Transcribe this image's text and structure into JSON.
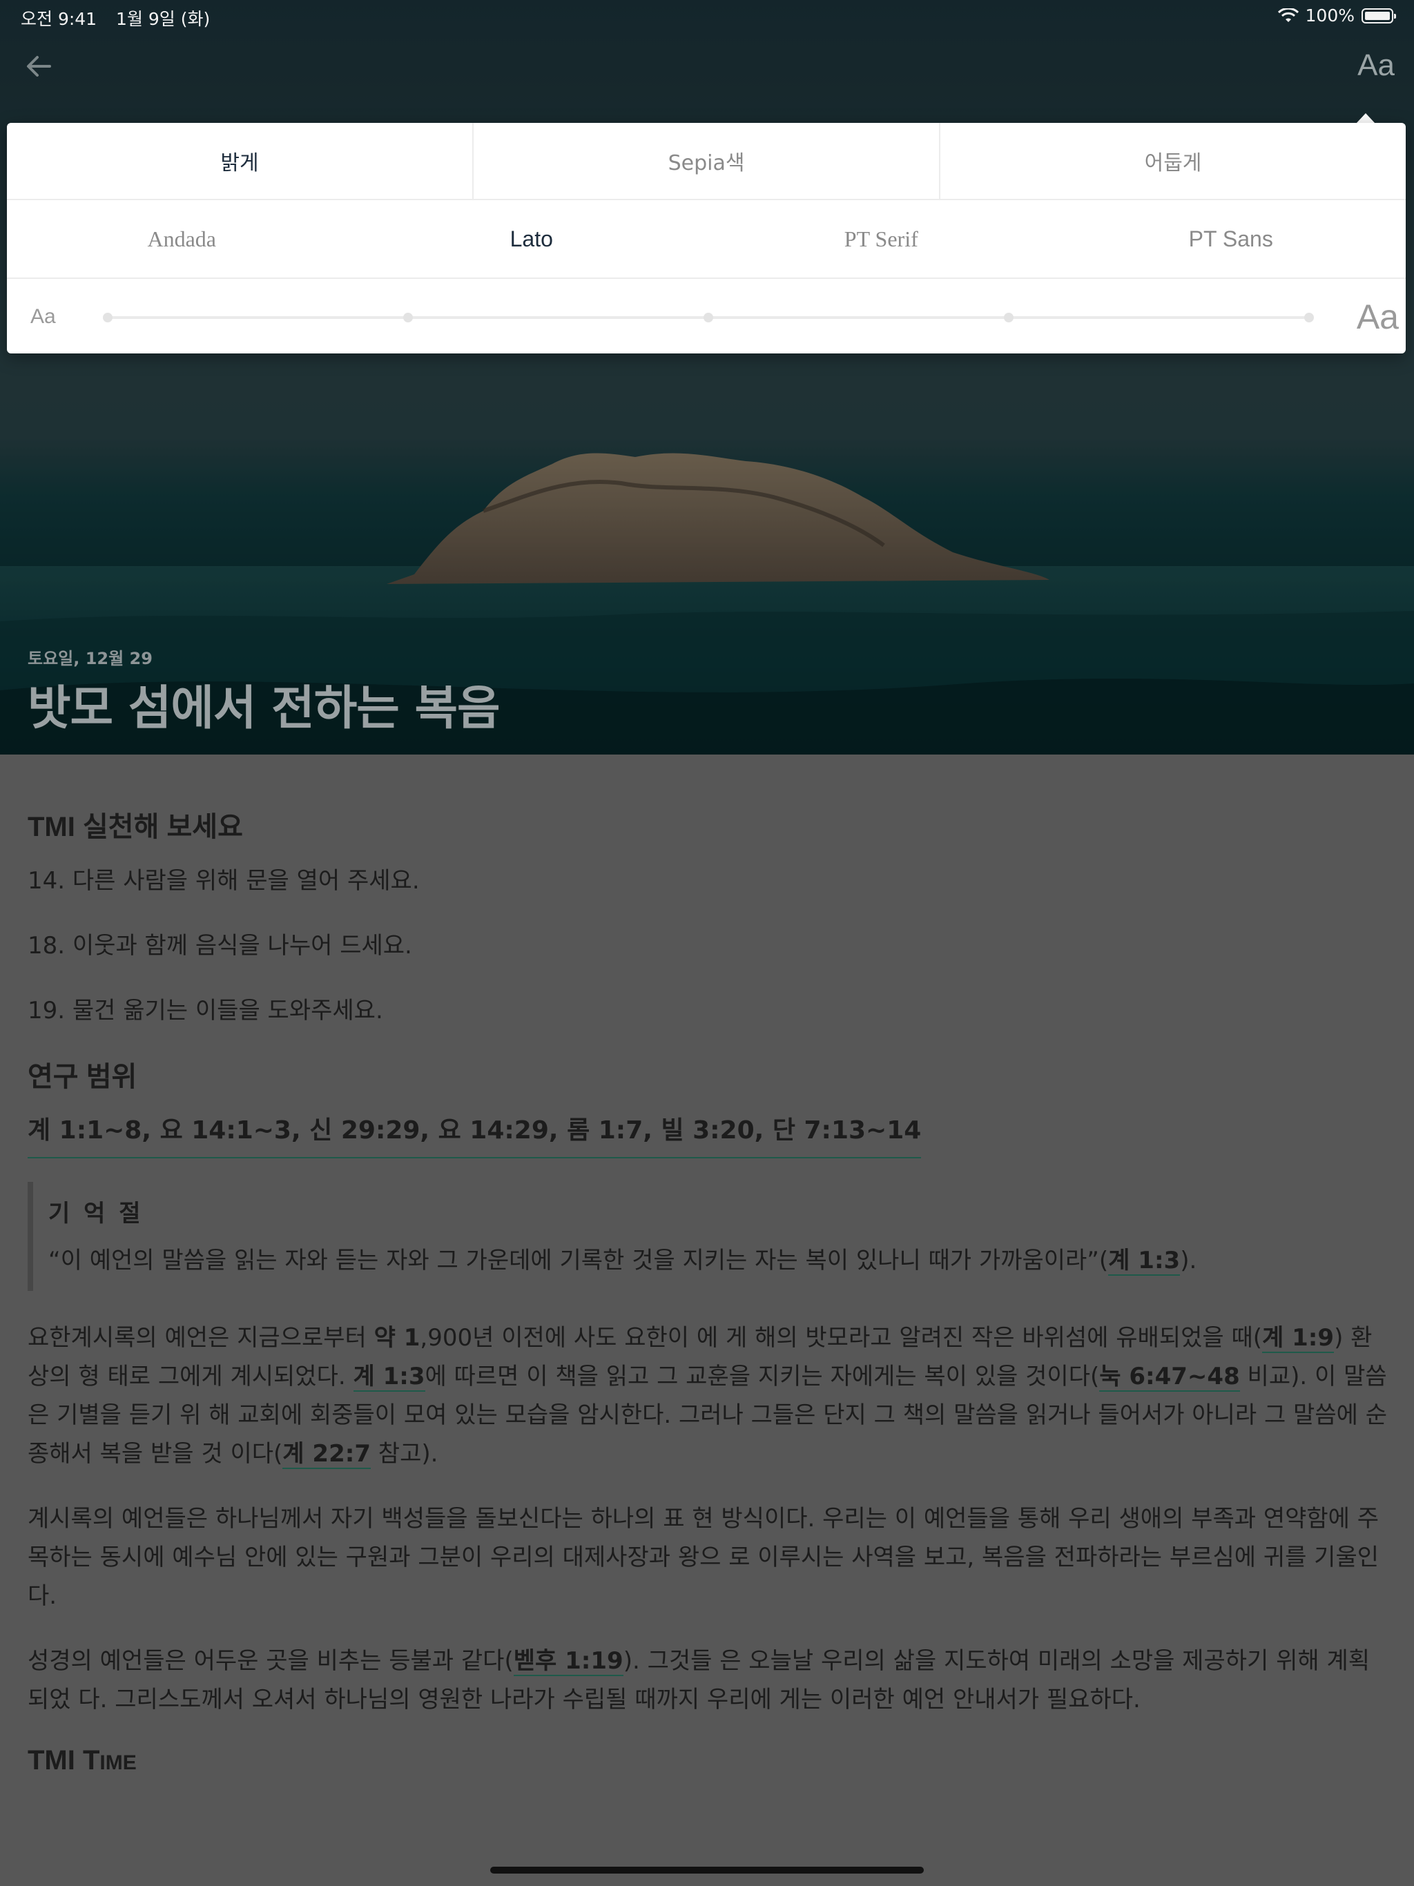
{
  "status_bar": {
    "time": "오전 9:41",
    "date": "1월 9일 (화)",
    "battery": "100%"
  },
  "header": {
    "back_icon": "arrow-left-icon",
    "font_settings_label": "Aa"
  },
  "hero": {
    "date": "토요일, 12월 29",
    "title": "밧모 섬에서 전하는 복음"
  },
  "reader_settings": {
    "themes": [
      {
        "label": "밝게",
        "selected": true
      },
      {
        "label": "Sepia색",
        "selected": false
      },
      {
        "label": "어둡게",
        "selected": false
      }
    ],
    "fonts": [
      {
        "label": "Andada",
        "selected": false
      },
      {
        "label": "Lato",
        "selected": true
      },
      {
        "label": "PT Serif",
        "selected": false
      },
      {
        "label": "PT Sans",
        "selected": false
      }
    ],
    "size_small_label": "Aa",
    "size_large_label": "Aa",
    "size_steps": 5,
    "size_level": 1
  },
  "article": {
    "practice_heading": "TMI 실천해 보세요",
    "practice_items": [
      "14. 다른 사람을 위해 문을 열어 주세요.",
      "18. 이웃과 함께 음식을 나누어 드세요.",
      "19. 물건 옮기는 이들을 도와주세요."
    ],
    "study_heading": "연구 범위",
    "study_range": "계 1:1~8, 요 14:1~3, 신 29:29, 요 14:29, 롬 1:7, 빌 3:20, 단 7:13~14",
    "memory_verse": {
      "heading": "기 억 절",
      "text": "“이 예언의 말씀을 읽는 자와 듣는 자와 그 가운데에 기록한 것을 지키는 자는 복이 있나니 때가 가까움이라”(",
      "ref": "계 1:3",
      "end": ")."
    },
    "p1": {
      "t1": "요한계시록의 예언은 지금으로부터 ",
      "bold1": "약 1",
      "t2": ",900년 이전에 사도 요한이 에 게 해의 밧모라고 알려진 작은 바위섬에 유배되었을 때(",
      "ref1": "계 1:9",
      "t3": ") 환상의 형 태로 그에게 계시되었다. ",
      "ref2": "계 1:3",
      "t4": "에 따르면 이 책을 읽고 그 교훈을 지키는 자에게는 복이 있을 것이다(",
      "ref3": "눅 6:47~48",
      "t5": " 비교). 이 말씀은 기별을 듣기 위 해 교회에 회중들이 모여 있는 모습을 암시한다. 그러나 그들은 단지 그 책의 말씀을 읽거나 들어서가 아니라 그 말씀에 순종해서 복을 받을 것 이다(",
      "ref4": "계 22:7",
      "t6": " 참고)."
    },
    "p2": "계시록의 예언들은 하나님께서 자기 백성들을 돌보신다는 하나의 표 현 방식이다. 우리는 이 예언들을 통해 우리 생애의 부족과 연약함에 주 목하는 동시에 예수님 안에 있는 구원과 그분이 우리의 대제사장과 왕으 로 이루시는 사역을 보고, 복음을 전파하라는 부르심에 귀를 기울인다.",
    "p3": {
      "t1": "성경의 예언들은 어두운 곳을 비추는 등불과 같다(",
      "ref1": "벧후 1:19",
      "t2": "). 그것들 은 오늘날 우리의 삶을 지도하여 미래의 소망을 제공하기 위해 계획되었 다. 그리스도께서 오셔서 하나님의 영원한 나라가 수립될 때까지 우리에 게는 이러한 예언 안내서가 필요하다."
    },
    "time_heading_a": "TMI T",
    "time_heading_b": "IME"
  },
  "colors": {
    "link_underline": "#1f5a4a",
    "selected_text": "#1e2d3d",
    "overlay": "#575757"
  }
}
